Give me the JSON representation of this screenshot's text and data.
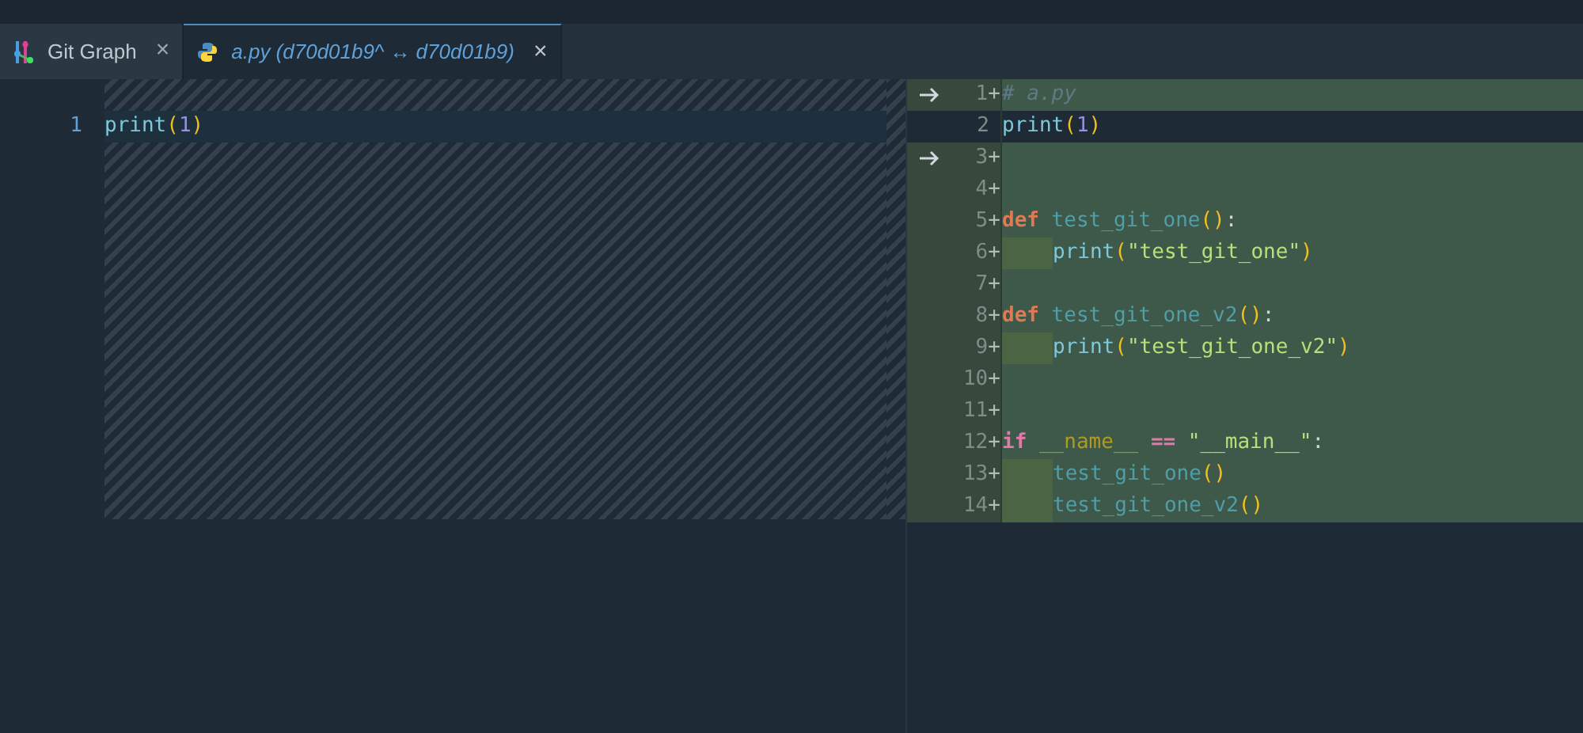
{
  "tabs": [
    {
      "label": "Git Graph",
      "kind": "git-graph",
      "italic": false,
      "selected": false,
      "close": "×"
    },
    {
      "label": "a.py (d70d01b9^ ↔ d70d01b9)",
      "kind": "python",
      "italic": true,
      "selected": true,
      "close": "×"
    }
  ],
  "left_editor": {
    "lines": [
      {
        "number": "1",
        "tokens": [
          {
            "kind": "function",
            "text": "print"
          },
          {
            "kind": "paren",
            "text": "("
          },
          {
            "kind": "number",
            "text": "1"
          },
          {
            "kind": "paren",
            "text": ")"
          }
        ]
      }
    ]
  },
  "right_editor": {
    "lines": [
      {
        "number": "1",
        "marker": "+",
        "added": true,
        "arrow": true,
        "indent": false,
        "tokens": [
          {
            "kind": "comment",
            "text": "# a.py"
          }
        ]
      },
      {
        "number": "2",
        "added": false,
        "arrow": false,
        "indent": false,
        "tokens": [
          {
            "kind": "function",
            "text": "print"
          },
          {
            "kind": "paren",
            "text": "("
          },
          {
            "kind": "number",
            "text": "1"
          },
          {
            "kind": "paren",
            "text": ")"
          }
        ]
      },
      {
        "number": "3",
        "marker": "+",
        "added": true,
        "arrow": true,
        "indent": false
      },
      {
        "number": "4",
        "marker": "+",
        "added": true,
        "arrow": false,
        "indent": false
      },
      {
        "number": "5",
        "marker": "+",
        "added": true,
        "arrow": false,
        "indent": false,
        "tokens": [
          {
            "kind": "keyword",
            "text": "def"
          },
          {
            "kind": "name",
            "text": " test_git_one"
          },
          {
            "kind": "paren",
            "text": "()"
          },
          {
            "kind": "plain",
            "text": ":"
          }
        ]
      },
      {
        "number": "6",
        "marker": "+",
        "added": true,
        "arrow": false,
        "indent": true,
        "tokens": [
          {
            "kind": "function",
            "text": "print"
          },
          {
            "kind": "paren",
            "text": "("
          },
          {
            "kind": "string",
            "text": "\"test_git_one\""
          },
          {
            "kind": "paren",
            "text": ")"
          }
        ]
      },
      {
        "number": "7",
        "marker": "+",
        "added": true,
        "arrow": false,
        "indent": false
      },
      {
        "number": "8",
        "marker": "+",
        "added": true,
        "arrow": false,
        "indent": false,
        "tokens": [
          {
            "kind": "keyword",
            "text": "def"
          },
          {
            "kind": "name",
            "text": " test_git_one_v2"
          },
          {
            "kind": "paren",
            "text": "()"
          },
          {
            "kind": "plain",
            "text": ":"
          }
        ]
      },
      {
        "number": "9",
        "marker": "+",
        "added": true,
        "arrow": false,
        "indent": true,
        "tokens": [
          {
            "kind": "function",
            "text": "print"
          },
          {
            "kind": "paren",
            "text": "("
          },
          {
            "kind": "string",
            "text": "\"test_git_one_v2\""
          },
          {
            "kind": "paren",
            "text": ")"
          }
        ]
      },
      {
        "number": "10",
        "marker": "+",
        "added": true,
        "arrow": false,
        "indent": false
      },
      {
        "number": "11",
        "marker": "+",
        "added": true,
        "arrow": false,
        "indent": false
      },
      {
        "number": "12",
        "marker": "+",
        "added": true,
        "arrow": false,
        "indent": false,
        "tokens": [
          {
            "kind": "control",
            "text": "if "
          },
          {
            "kind": "variable",
            "text": "__name__ "
          },
          {
            "kind": "operator",
            "text": "== "
          },
          {
            "kind": "string",
            "text": "\"__main__\""
          },
          {
            "kind": "plain",
            "text": ":"
          }
        ]
      },
      {
        "number": "13",
        "marker": "+",
        "added": true,
        "arrow": false,
        "indent": true,
        "tokens": [
          {
            "kind": "name",
            "text": "test_git_one"
          },
          {
            "kind": "paren",
            "text": "()"
          }
        ]
      },
      {
        "number": "14",
        "marker": "+",
        "added": true,
        "arrow": false,
        "indent": true,
        "tokens": [
          {
            "kind": "name",
            "text": "test_git_one_v2"
          },
          {
            "kind": "paren",
            "text": "()"
          }
        ]
      }
    ]
  }
}
